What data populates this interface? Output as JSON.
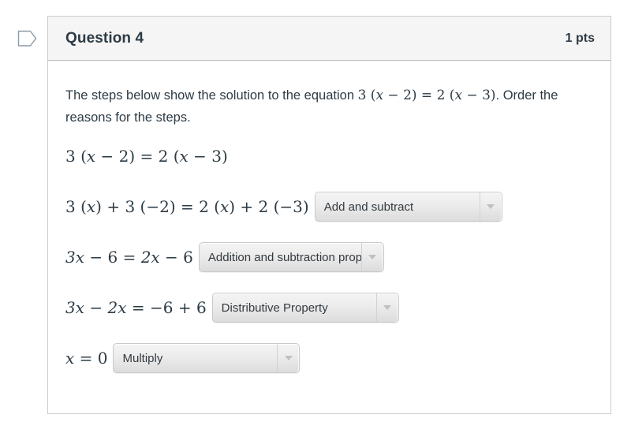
{
  "flag": {
    "icon": "flag-outline-icon"
  },
  "header": {
    "title": "Question 4",
    "points": "1 pts"
  },
  "prompt": {
    "text_before": "The steps below show the solution to the equation ",
    "equation": "3 (x − 2) = 2 (x − 3)",
    "text_after": ". Order the reasons for the steps."
  },
  "steps": [
    {
      "expression": "3 (x − 2) = 2 (x − 3)",
      "has_dropdown": false,
      "selected": ""
    },
    {
      "expression": "3 (x) + 3 (−2) = 2 (x) + 2 (−3)",
      "has_dropdown": true,
      "selected": "Add and subtract"
    },
    {
      "expression": "3x − 6 = 2x − 6",
      "has_dropdown": true,
      "selected": "Addition and subtraction prop"
    },
    {
      "expression": "3x − 2x = −6 + 6",
      "has_dropdown": true,
      "selected": "Distributive Property"
    },
    {
      "expression": "x = 0",
      "has_dropdown": true,
      "selected": "Multiply"
    }
  ],
  "colors": {
    "header_bg": "#f5f5f5",
    "card_border": "#c7cdd1",
    "text": "#2d3b45",
    "dropdown_border": "#c9c9c9"
  }
}
